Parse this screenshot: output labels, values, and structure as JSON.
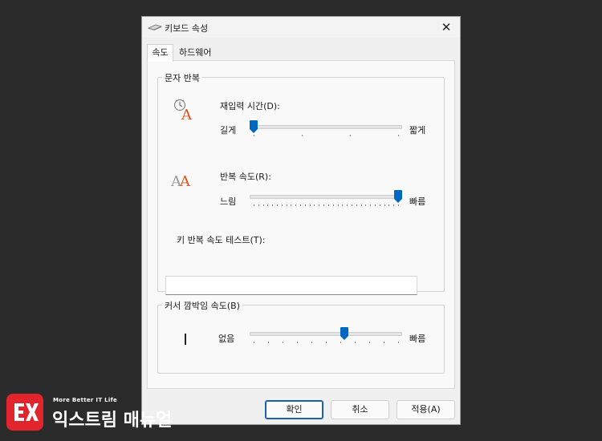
{
  "window": {
    "title": "키보드 속성",
    "close_glyph": "✕"
  },
  "tabs": [
    {
      "label": "속도",
      "active": true
    },
    {
      "label": "하드웨어",
      "active": false
    }
  ],
  "char_repeat": {
    "group_title": "문자 반복",
    "delay": {
      "label": "재입력 시간(D):",
      "left_label": "길게",
      "right_label": "짧게",
      "value": 0,
      "min": 0,
      "max": 3
    },
    "rate": {
      "label": "반복 속도(R):",
      "left_label": "느림",
      "right_label": "빠름",
      "value": 31,
      "min": 0,
      "max": 31
    },
    "test_label": "키 반복 속도 테스트(T):",
    "test_value": ""
  },
  "cursor_blink": {
    "group_title": "커서 깜박임 속도(B)",
    "left_label": "없음",
    "right_label": "빠름",
    "value": 0.63
  },
  "buttons": {
    "ok": "확인",
    "cancel": "취소",
    "apply": "적용(A)"
  },
  "watermark": {
    "tagline": "More Better IT Life",
    "brand": "익스트림 매뉴얼"
  },
  "colors": {
    "accent": "#0067c0",
    "background": "#2b2b2b",
    "logo": "#e2242c"
  }
}
